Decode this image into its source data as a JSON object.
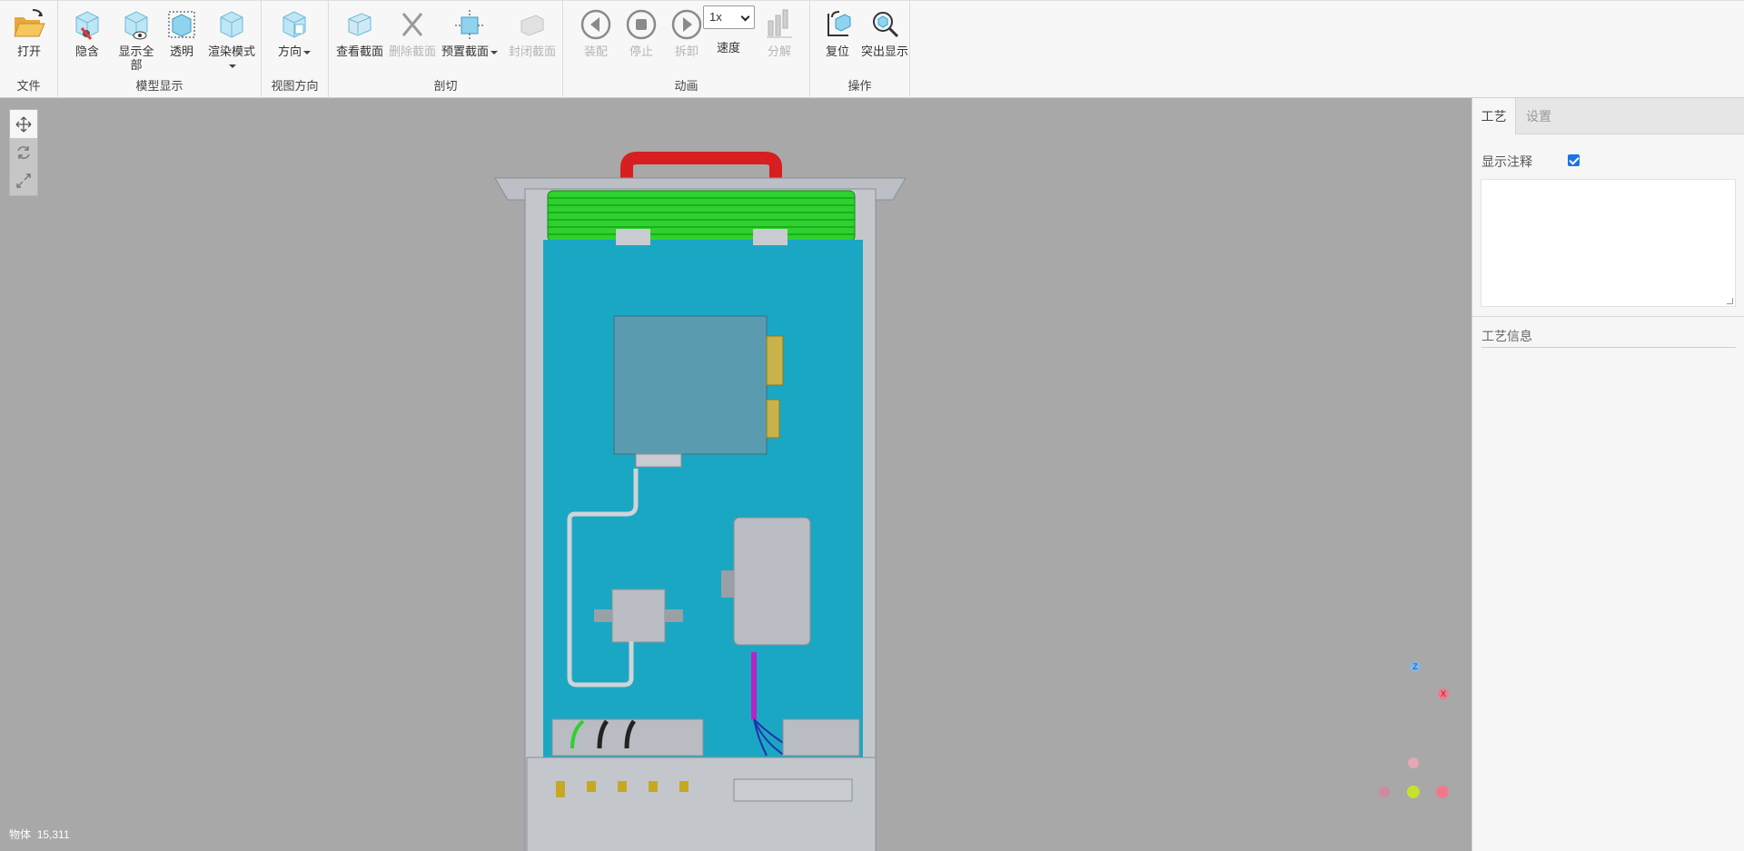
{
  "toolbar": {
    "groups": {
      "file": "文件",
      "model_display": "模型显示",
      "view_direction": "视图方向",
      "section": "剖切",
      "animation": "动画",
      "operation": "操作"
    },
    "buttons": {
      "open": "打开",
      "hide": "隐含",
      "show_all": "显示全部",
      "transparent": "透明",
      "render_mode": "渲染模式",
      "direction": "方向",
      "view_section": "查看截面",
      "delete_section": "删除截面",
      "preset_section": "预置截面",
      "close_section": "封闭截面",
      "assemble": "装配",
      "stop": "停止",
      "disassemble": "拆卸",
      "speed": "速度",
      "explode": "分解",
      "reset": "复位",
      "highlight": "突出显示"
    },
    "speed_value": "1x"
  },
  "viewport": {
    "object_label": "物体",
    "object_count": "15,311",
    "axes": {
      "z": "Z",
      "x": "X"
    },
    "colors": {
      "background": "#a8a8a8",
      "panel": "#1aa7c4",
      "handle": "#d81e1e",
      "fins": "#2ed12e"
    }
  },
  "panel": {
    "tabs": [
      "工艺",
      "设置"
    ],
    "show_annotation": "显示注释",
    "process_info": "工艺信息"
  }
}
